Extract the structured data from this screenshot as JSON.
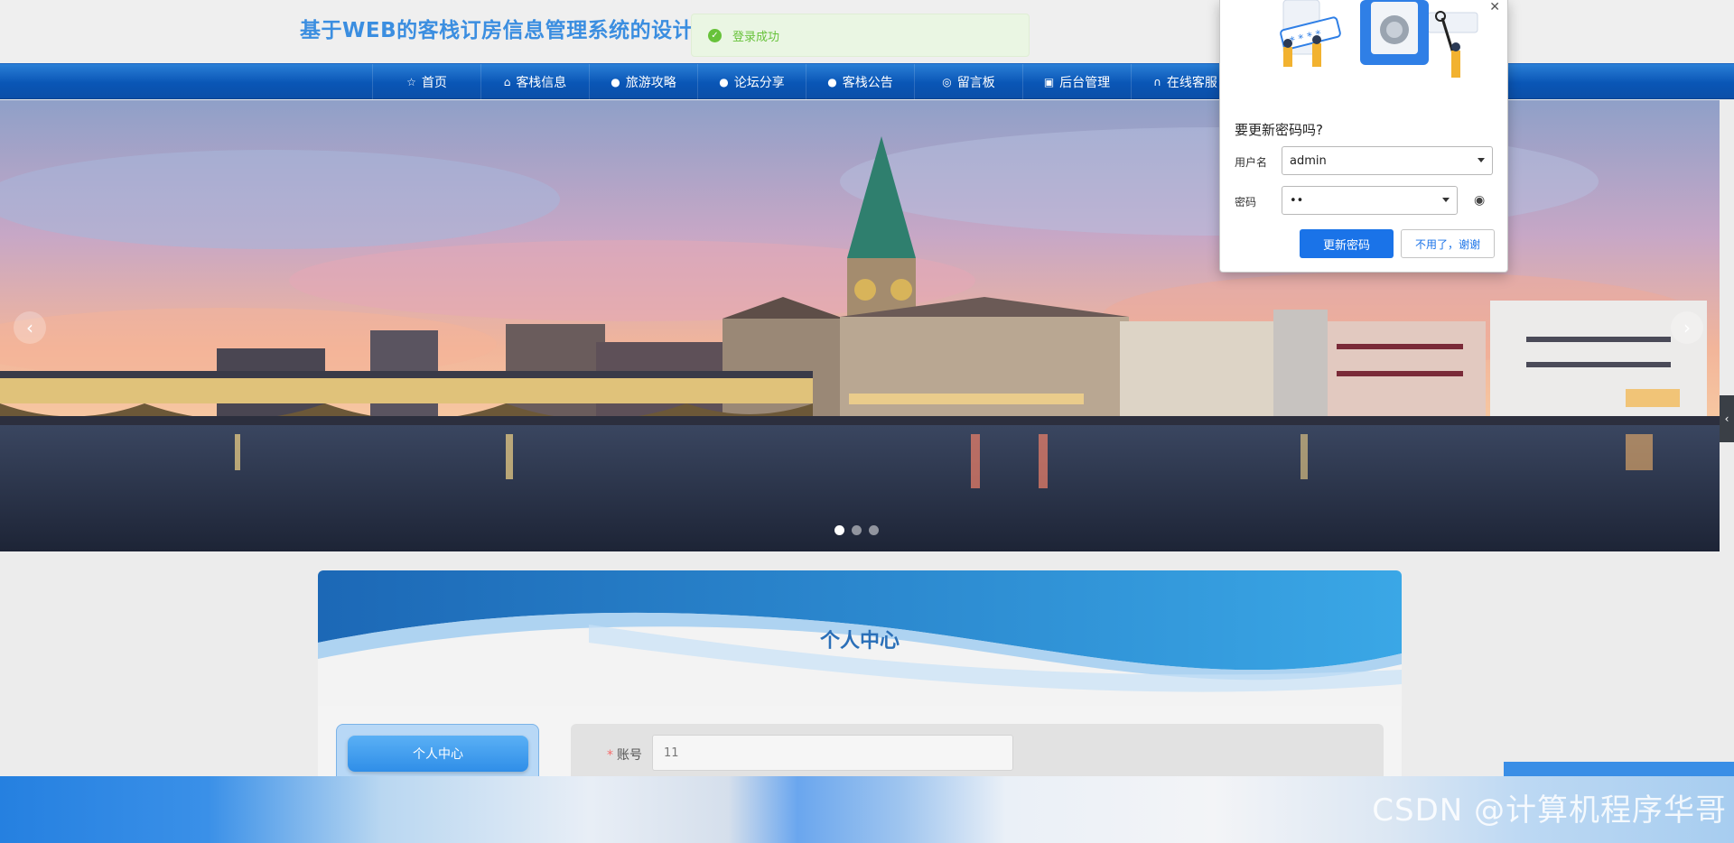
{
  "header": {
    "site_title": "基于WEB的客栈订房信息管理系统的设计"
  },
  "toast": {
    "icon": "check-circle-icon",
    "message": "登录成功",
    "color": "#67c23a"
  },
  "nav": {
    "items": [
      {
        "label": "首页",
        "icon": "star-icon"
      },
      {
        "label": "客栈信息",
        "icon": "bag-icon"
      },
      {
        "label": "旅游攻略",
        "icon": "info-icon"
      },
      {
        "label": "论坛分享",
        "icon": "question-icon"
      },
      {
        "label": "客栈公告",
        "icon": "info-icon"
      },
      {
        "label": "留言板",
        "icon": "target-icon"
      },
      {
        "label": "后台管理",
        "icon": "box-icon"
      },
      {
        "label": "在线客服",
        "icon": "headset-icon"
      }
    ],
    "color": "#0a56b6"
  },
  "carousel": {
    "prev_glyph": "‹",
    "next_glyph": "›",
    "slide_count": 3,
    "active_index": 0
  },
  "side_tab": {
    "glyph": "‹"
  },
  "personal_center": {
    "title": "个人中心",
    "menu_item": "个人中心",
    "account_label": "账号",
    "required_mark": "*",
    "account_value": "11"
  },
  "watermark": "CSDN @计算机程序华哥",
  "password_popup": {
    "question": "要更新密码吗?",
    "username_label": "用户名",
    "username_value": "admin",
    "password_label": "密码",
    "password_value": "••",
    "update_button": "更新密码",
    "decline_button": "不用了，谢谢",
    "close_glyph": "✕",
    "accent": "#1a73e8"
  }
}
